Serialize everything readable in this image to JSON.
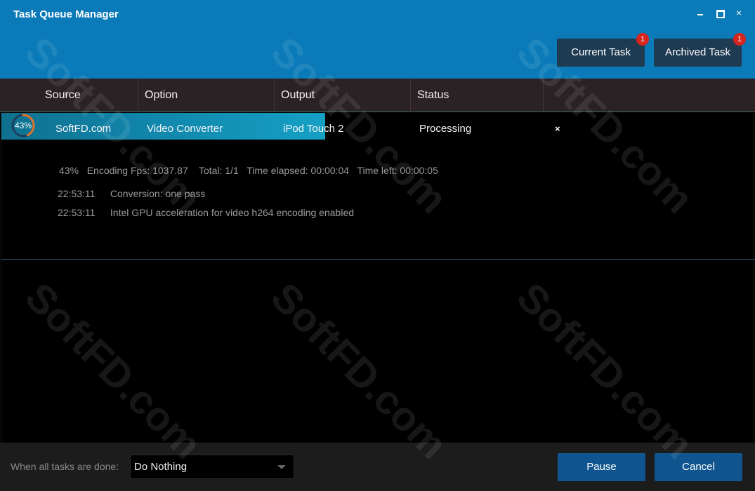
{
  "window": {
    "title": "Task Queue Manager",
    "controls": {
      "minimize": "",
      "maximize": "",
      "close": "×"
    }
  },
  "header": {
    "current_task": {
      "label": "Current Task",
      "badge": "1"
    },
    "archived_task": {
      "label": "Archived Task",
      "badge": "1"
    }
  },
  "columns": [
    "Source",
    "Option",
    "Output",
    "Status"
  ],
  "task": {
    "progress_percent": 43,
    "progress_label": "43%",
    "source": "SoftFD.com",
    "option": "Video Converter",
    "output": "iPod Touch 2",
    "status": "Processing",
    "remove_icon": "×",
    "detail": "43%   Encoding Fps: 1037.87    Total: 1/1   Time elapsed: 00:00:04   Time left: 00:00:05",
    "log": [
      {
        "time": "22:53:11",
        "message": "Conversion: one pass"
      },
      {
        "time": "22:53:11",
        "message": "Intel GPU acceleration for video h264 encoding enabled"
      }
    ]
  },
  "footer": {
    "when_done_label": "When all tasks are done:",
    "when_done_value": "Do Nothing",
    "pause_label": "Pause",
    "cancel_label": "Cancel"
  },
  "watermark": "SoftFD.com",
  "colors": {
    "header_bg": "#0a7ab8",
    "button_dark": "#1f3b52",
    "badge": "#d6241f",
    "progress": "#1183a8",
    "primary_button": "#10558f"
  }
}
